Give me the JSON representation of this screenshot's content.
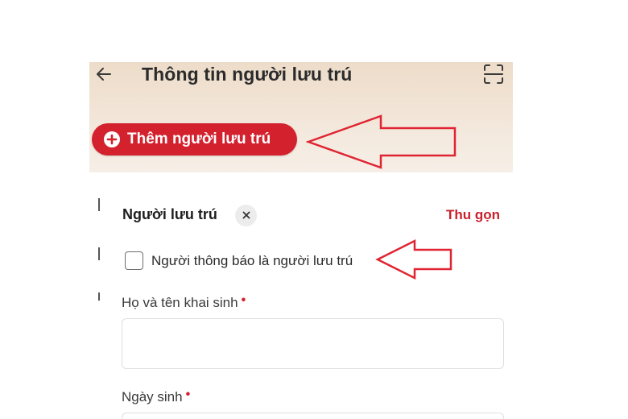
{
  "header": {
    "title": "Thông tin người lưu trú",
    "back_icon": "arrow-left-icon",
    "scan_icon": "scan-frame-icon",
    "background": "#eddcc9"
  },
  "add_button": {
    "label": "Thêm người lưu trú",
    "icon": "plus-circle-icon",
    "color": "#d4212e"
  },
  "resident_section": {
    "title": "Người lưu trú",
    "remove_icon": "close-icon",
    "collapse_label": "Thu gọn",
    "checkbox": {
      "label": "Người thông báo là người lưu trú",
      "checked": false
    },
    "fields": [
      {
        "label": "Họ và tên khai sinh",
        "required": true,
        "value": ""
      },
      {
        "label": "Ngày sinh",
        "required": true,
        "value": ""
      }
    ]
  },
  "annotations": {
    "arrow_color": "#e02432"
  },
  "colors": {
    "accent": "#d4212e",
    "text": "#1f1f1f"
  }
}
